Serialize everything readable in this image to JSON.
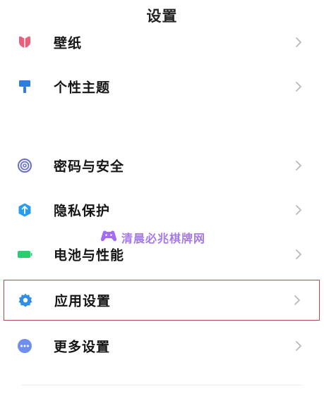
{
  "header": {
    "title": "设置"
  },
  "items": [
    {
      "label": "壁纸",
      "icon": "wallpaper-icon",
      "color": "#e8607a"
    },
    {
      "label": "个性主题",
      "icon": "theme-brush-icon",
      "color": "#2f7de1"
    },
    {
      "label": "密码与安全",
      "icon": "fingerprint-icon",
      "color": "#6a6fcf"
    },
    {
      "label": "隐私保护",
      "icon": "privacy-shield-icon",
      "color": "#2a9cf0"
    },
    {
      "label": "电池与性能",
      "icon": "battery-icon",
      "color": "#2ecc71"
    },
    {
      "label": "应用设置",
      "icon": "gear-icon",
      "color": "#2f8ee6",
      "selected": true
    },
    {
      "label": "更多设置",
      "icon": "more-dots-icon",
      "color": "#6f8ff0"
    }
  ],
  "watermark": {
    "text": "清晨必兆棋牌网",
    "icon": "game-controller-icon",
    "color": "#8a4be0"
  },
  "highlight_color": "#b04a4a"
}
